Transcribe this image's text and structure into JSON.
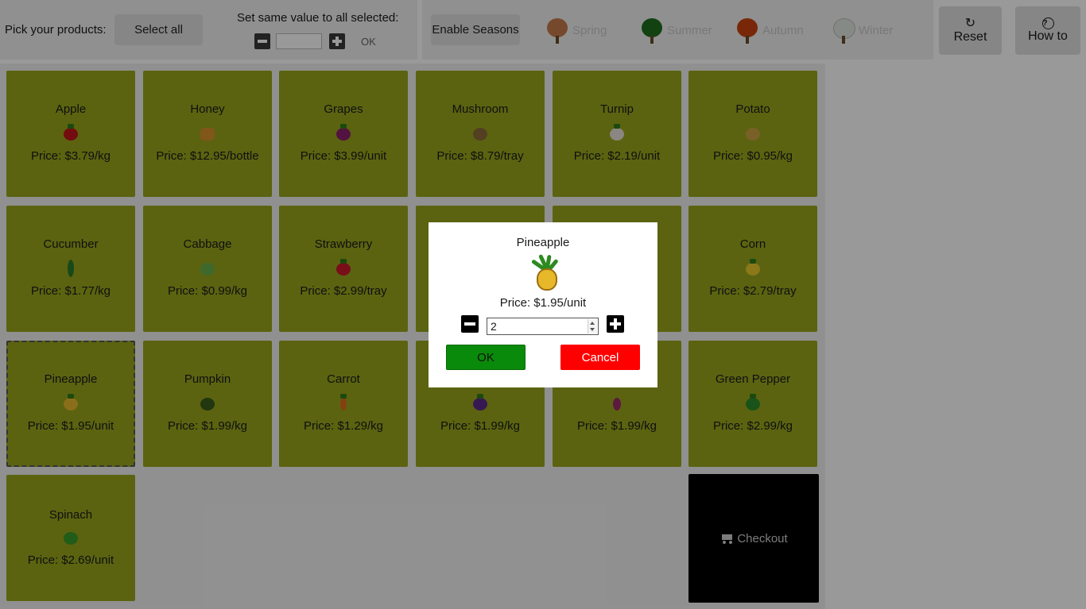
{
  "toolbar": {
    "pick_label": "Pick your products:",
    "select_all": "Select all",
    "same_value_label": "Set same value to all selected:",
    "bulk_value": "",
    "bulk_ok": "OK",
    "enable_seasons": "Enable Seasons",
    "seasons": [
      {
        "label": "Spring",
        "icon": "spring-tree-icon",
        "color": "#c77a4a"
      },
      {
        "label": "Summer",
        "icon": "summer-tree-icon",
        "color": "#1e6f1e"
      },
      {
        "label": "Autumn",
        "icon": "autumn-tree-icon",
        "color": "#c8440e"
      },
      {
        "label": "Winter",
        "icon": "winter-tree-icon",
        "color": "#cfd8cf"
      }
    ],
    "reset": "Reset",
    "howto": "How to"
  },
  "products": [
    {
      "name": "Apple",
      "price": "Price: $3.79/kg",
      "color": "#c0161a"
    },
    {
      "name": "Honey",
      "price": "Price: $12.95/bottle",
      "color": "#d8902a"
    },
    {
      "name": "Grapes",
      "price": "Price: $3.99/unit",
      "color": "#8a1e6a"
    },
    {
      "name": "Mushroom",
      "price": "Price: $8.79/tray",
      "color": "#8a6a3a"
    },
    {
      "name": "Turnip",
      "price": "Price: $2.19/unit",
      "color": "#e8e0d8"
    },
    {
      "name": "Potato",
      "price": "Price: $0.95/kg",
      "color": "#c8a040"
    },
    {
      "name": "Cucumber",
      "price": "Price: $1.77/kg",
      "color": "#2a7a2a"
    },
    {
      "name": "Cabbage",
      "price": "Price: $0.99/kg",
      "color": "#6ab04a"
    },
    {
      "name": "Strawberry",
      "price": "Price: $2.99/tray",
      "color": "#c81a2a"
    },
    {
      "name": "Corn",
      "price": "Price: $2.79/tray",
      "color": "#e8c82a"
    },
    {
      "name": "Pineapple",
      "price": "Price: $1.95/unit",
      "color": "#e6b82a"
    },
    {
      "name": "Pumpkin",
      "price": "Price: $1.99/kg",
      "color": "#3a5a1a"
    },
    {
      "name": "Carrot",
      "price": "Price: $1.29/kg",
      "color": "#e06a1a"
    },
    {
      "name": "",
      "price": "Price: $1.99/kg",
      "color": "#5a2a8a"
    },
    {
      "name": "",
      "price": "Price: $1.99/kg",
      "color": "#9a2a6a"
    },
    {
      "name": "Green Pepper",
      "price": "Price: $2.99/kg",
      "color": "#2a8a2a"
    },
    {
      "name": "Spinach",
      "price": "Price: $2.69/unit",
      "color": "#3a9a2a"
    }
  ],
  "checkout": "Checkout",
  "modal": {
    "name": "Pineapple",
    "price": "Price: $1.95/unit",
    "quantity": "2",
    "ok": "OK",
    "cancel": "Cancel"
  }
}
